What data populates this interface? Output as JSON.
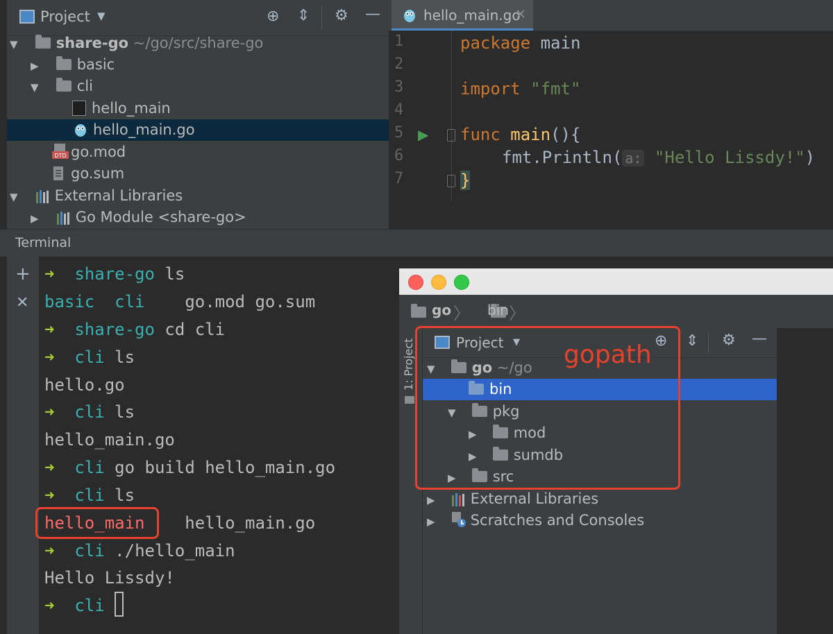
{
  "project_panel": {
    "title": "Project",
    "tree": [
      {
        "label": "share-go",
        "path": "~/go/src/share-go"
      },
      {
        "label": "basic"
      },
      {
        "label": "cli"
      },
      {
        "label": "hello_main"
      },
      {
        "label": "hello_main.go"
      },
      {
        "label": "go.mod"
      },
      {
        "label": "go.sum"
      },
      {
        "label": "External Libraries"
      },
      {
        "label": "Go Module <share-go>"
      }
    ]
  },
  "editor": {
    "tab_label": "hello_main.go",
    "line_numbers": [
      "1",
      "2",
      "3",
      "4",
      "5",
      "6",
      "7"
    ],
    "code": {
      "l1_kw": "package",
      "l1_name": " main",
      "l3_kw": "import",
      "l3_str": " \"fmt\"",
      "l5_kw": "func",
      "l5_fn": " main",
      "l5_rest": "(){",
      "l6_call": "fmt.Println(",
      "l6_hint": "a:",
      "l6_str": " \"Hello Lissdy!\"",
      "l6_close": ")",
      "l7": "}"
    }
  },
  "terminal": {
    "title": "Terminal",
    "prompt_arrow": "➜",
    "lines": [
      {
        "dir": "share-go",
        "cmd": " ls"
      },
      {
        "out_dir1": "basic",
        "out_dir2": "cli",
        "out_files": "go.mod go.sum"
      },
      {
        "dir": "share-go",
        "cmd": " cd cli"
      },
      {
        "dir": "cli",
        "cmd": " ls"
      },
      {
        "out": "hello.go"
      },
      {
        "dir": "cli",
        "cmd": " ls"
      },
      {
        "out": "hello_main.go"
      },
      {
        "dir": "cli",
        "cmd": " go build hello_main.go"
      },
      {
        "dir": "cli",
        "cmd": " ls"
      },
      {
        "out_red": "hello_main",
        "out_files": "hello_main.go"
      },
      {
        "dir": "cli",
        "cmd": " ./hello_main"
      },
      {
        "out": "Hello Lissdy!"
      },
      {
        "dir": "cli"
      }
    ]
  },
  "overlay": {
    "breadcrumb": [
      "go",
      "bin"
    ],
    "side_tab": "1: Project",
    "panel_title": "Project",
    "tree": [
      {
        "label": "go",
        "path": "~/go"
      },
      {
        "label": "bin"
      },
      {
        "label": "pkg"
      },
      {
        "label": "mod"
      },
      {
        "label": "sumdb"
      },
      {
        "label": "src"
      },
      {
        "label": "External Libraries"
      },
      {
        "label": "Scratches and Consoles"
      }
    ],
    "annotation": "gopath"
  },
  "colors": {
    "selection": "#2f65ca",
    "annotation": "#e8422c",
    "prompt_arrow": "#a7c934",
    "prompt_dir": "#3bb0b0"
  }
}
